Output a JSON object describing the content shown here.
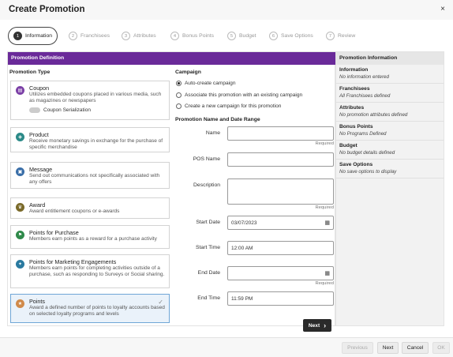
{
  "dialog": {
    "title": "Create Promotion",
    "close_glyph": "×"
  },
  "steps": [
    {
      "num": "1",
      "label": "Information"
    },
    {
      "num": "2",
      "label": "Franchisees"
    },
    {
      "num": "3",
      "label": "Attributes"
    },
    {
      "num": "4",
      "label": "Bonus Points"
    },
    {
      "num": "5",
      "label": "Budget"
    },
    {
      "num": "6",
      "label": "Save Options"
    },
    {
      "num": "7",
      "label": "Review"
    }
  ],
  "definition": {
    "header": "Promotion Definition",
    "type_title": "Promotion Type",
    "types": [
      {
        "title": "Coupon",
        "desc": "Utilizes embedded coupons placed in various media, such as magazines or newspapers",
        "icon": "coupon-icon",
        "toggle_label": "Coupon Serialization"
      },
      {
        "title": "Product",
        "desc": "Receive monetary savings in exchange for the purchase of specific merchandise",
        "icon": "product-icon"
      },
      {
        "title": "Message",
        "desc": "Send out communications not specifically associated with any offers",
        "icon": "message-icon"
      },
      {
        "title": "Award",
        "desc": "Award entitlement coupons or e-awards",
        "icon": "award-icon"
      },
      {
        "title": "Points for Purchase",
        "desc": "Members earn points as a reward for a purchase activity",
        "icon": "flag-icon"
      },
      {
        "title": "Points for Marketing Engagements",
        "desc": "Members earn points for completing activities outside of a purchase, such as responding to Surveys or Social sharing.",
        "icon": "engagement-icon"
      },
      {
        "title": "Points",
        "desc": "Award a defined number of points to loyalty accounts based on selected loyalty programs and levels",
        "icon": "star-icon",
        "selected": true
      }
    ],
    "campaign": {
      "title": "Campaign",
      "options": [
        "Auto-create campaign",
        "Associate this promotion with an existing campaign",
        "Create a new campaign for this promotion"
      ],
      "selected_index": 0
    },
    "name_date": {
      "title": "Promotion Name and Date Range",
      "required_text": "Required",
      "name_label": "Name",
      "name_value": "",
      "pos_label": "POS Name",
      "pos_value": "",
      "desc_label": "Description",
      "desc_value": "",
      "start_date_label": "Start Date",
      "start_date_value": "03/07/2023",
      "start_time_label": "Start Time",
      "start_time_value": "12:00 AM",
      "end_date_label": "End Date",
      "end_date_value": "",
      "end_time_label": "End Time",
      "end_time_value": "11:59 PM"
    },
    "next_label": "Next",
    "next_glyph": "›"
  },
  "info_panel": {
    "header": "Promotion Information",
    "items": [
      {
        "title": "Information",
        "value": "No information entered"
      },
      {
        "title": "Franchisees",
        "value": "All Franchisees defined"
      },
      {
        "title": "Attributes",
        "value": "No promotion attributes defined"
      },
      {
        "title": "Bonus Points",
        "value": "No Programs Defined"
      },
      {
        "title": "Budget",
        "value": "No budget details defined"
      },
      {
        "title": "Save Options",
        "value": "No save options to display"
      }
    ]
  },
  "footer": {
    "previous": "Previous",
    "next": "Next",
    "cancel": "Cancel",
    "ok": "OK"
  },
  "colors": {
    "accent_purple": "#6a2a99",
    "selected_bg": "#eaf2fa",
    "icon_purple": "#7b3fa6",
    "icon_teal": "#2c8a88",
    "icon_blue": "#3a6ea8",
    "icon_olive": "#7a6a2a",
    "icon_green": "#2f8a4a",
    "icon_star": "#d08a4a"
  }
}
